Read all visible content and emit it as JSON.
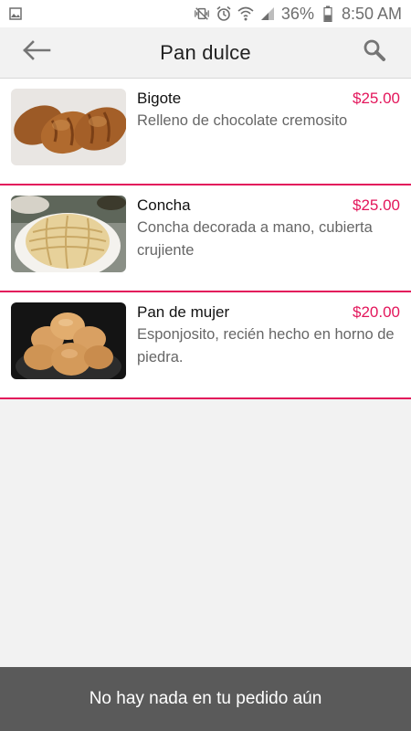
{
  "status_bar": {
    "battery": "36%",
    "time": "8:50 AM"
  },
  "app_bar": {
    "title": "Pan dulce"
  },
  "products": [
    {
      "name": "Bigote",
      "price": "$25.00",
      "description": "Relleno de chocolate cremosito"
    },
    {
      "name": "Concha",
      "price": "$25.00",
      "description": "Concha decorada a mano, cubierta crujiente"
    },
    {
      "name": "Pan de mujer",
      "price": "$20.00",
      "description": "Esponjosito, recién hecho en horno de piedra."
    }
  ],
  "order_bar": {
    "text": "No hay nada en tu pedido aún"
  },
  "colors": {
    "accent": "#e3165b",
    "bottom_bar": "#5a5a5a"
  }
}
